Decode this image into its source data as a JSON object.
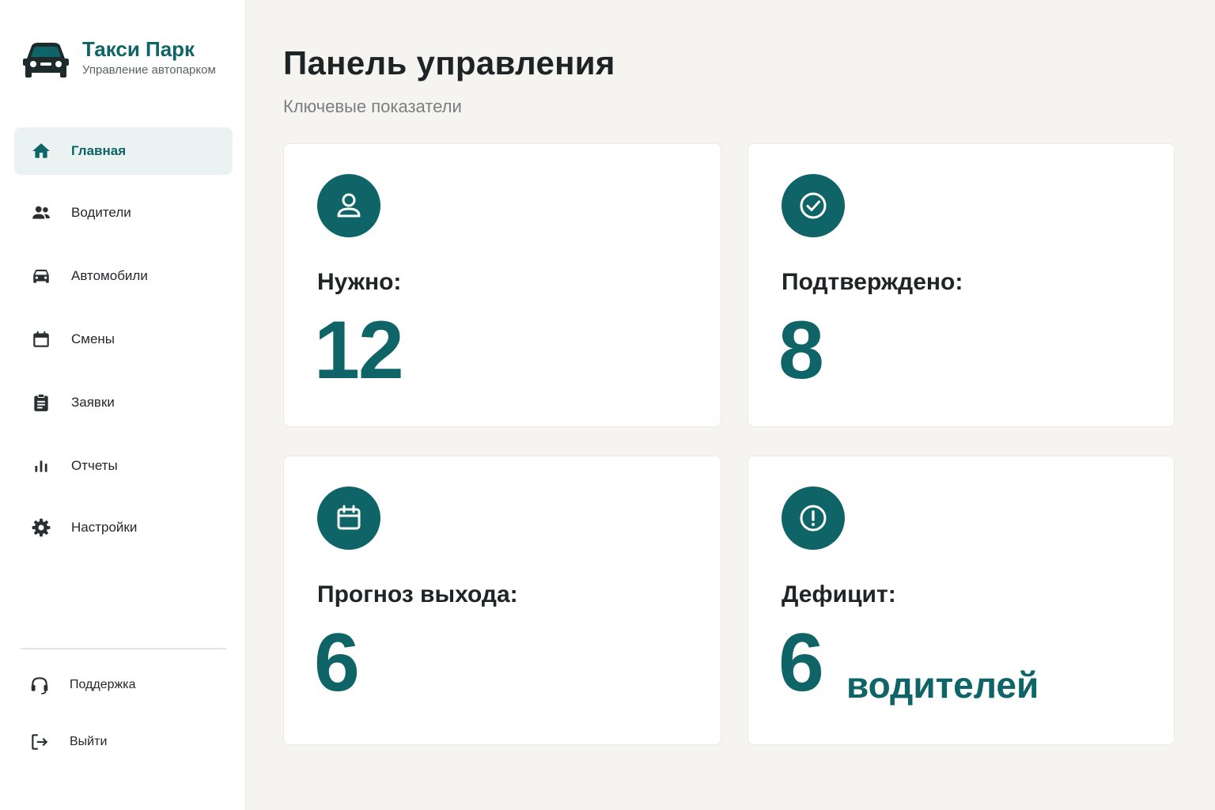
{
  "brand": {
    "title": "Такси Парк",
    "subtitle": "Управление автопарком"
  },
  "sidebar": {
    "items": [
      {
        "label": "Главная",
        "icon": "home-icon",
        "active": true
      },
      {
        "label": "Водители",
        "icon": "people-icon"
      },
      {
        "label": "Автомобили",
        "icon": "car-icon"
      },
      {
        "label": "Смены",
        "icon": "calendar-icon"
      },
      {
        "label": "Заявки",
        "icon": "clipboard-icon"
      },
      {
        "label": "Отчеты",
        "icon": "bar-chart-icon"
      },
      {
        "label": "Настройки",
        "icon": "gear-icon"
      }
    ],
    "bottom": [
      {
        "label": "Поддержка",
        "icon": "headset-icon"
      },
      {
        "label": "Выйти",
        "icon": "logout-icon"
      }
    ]
  },
  "main": {
    "title": "Панель управления",
    "subtitle": "Ключевые показатели",
    "cards": [
      {
        "label": "Нужно:",
        "value": "12",
        "icon": "user-icon"
      },
      {
        "label": "Подтверждено:",
        "value": "8",
        "icon": "check-circle-icon"
      },
      {
        "label": "Прогноз выхода:",
        "value": "6",
        "icon": "calendar-icon"
      },
      {
        "label": "Дефицит:",
        "value": "6",
        "unit": "водителей",
        "icon": "alert-circle-icon"
      }
    ]
  },
  "colors": {
    "accent": "#0e6467",
    "active_bg": "#eaf2f2",
    "page_bg": "#f5f4f1"
  }
}
